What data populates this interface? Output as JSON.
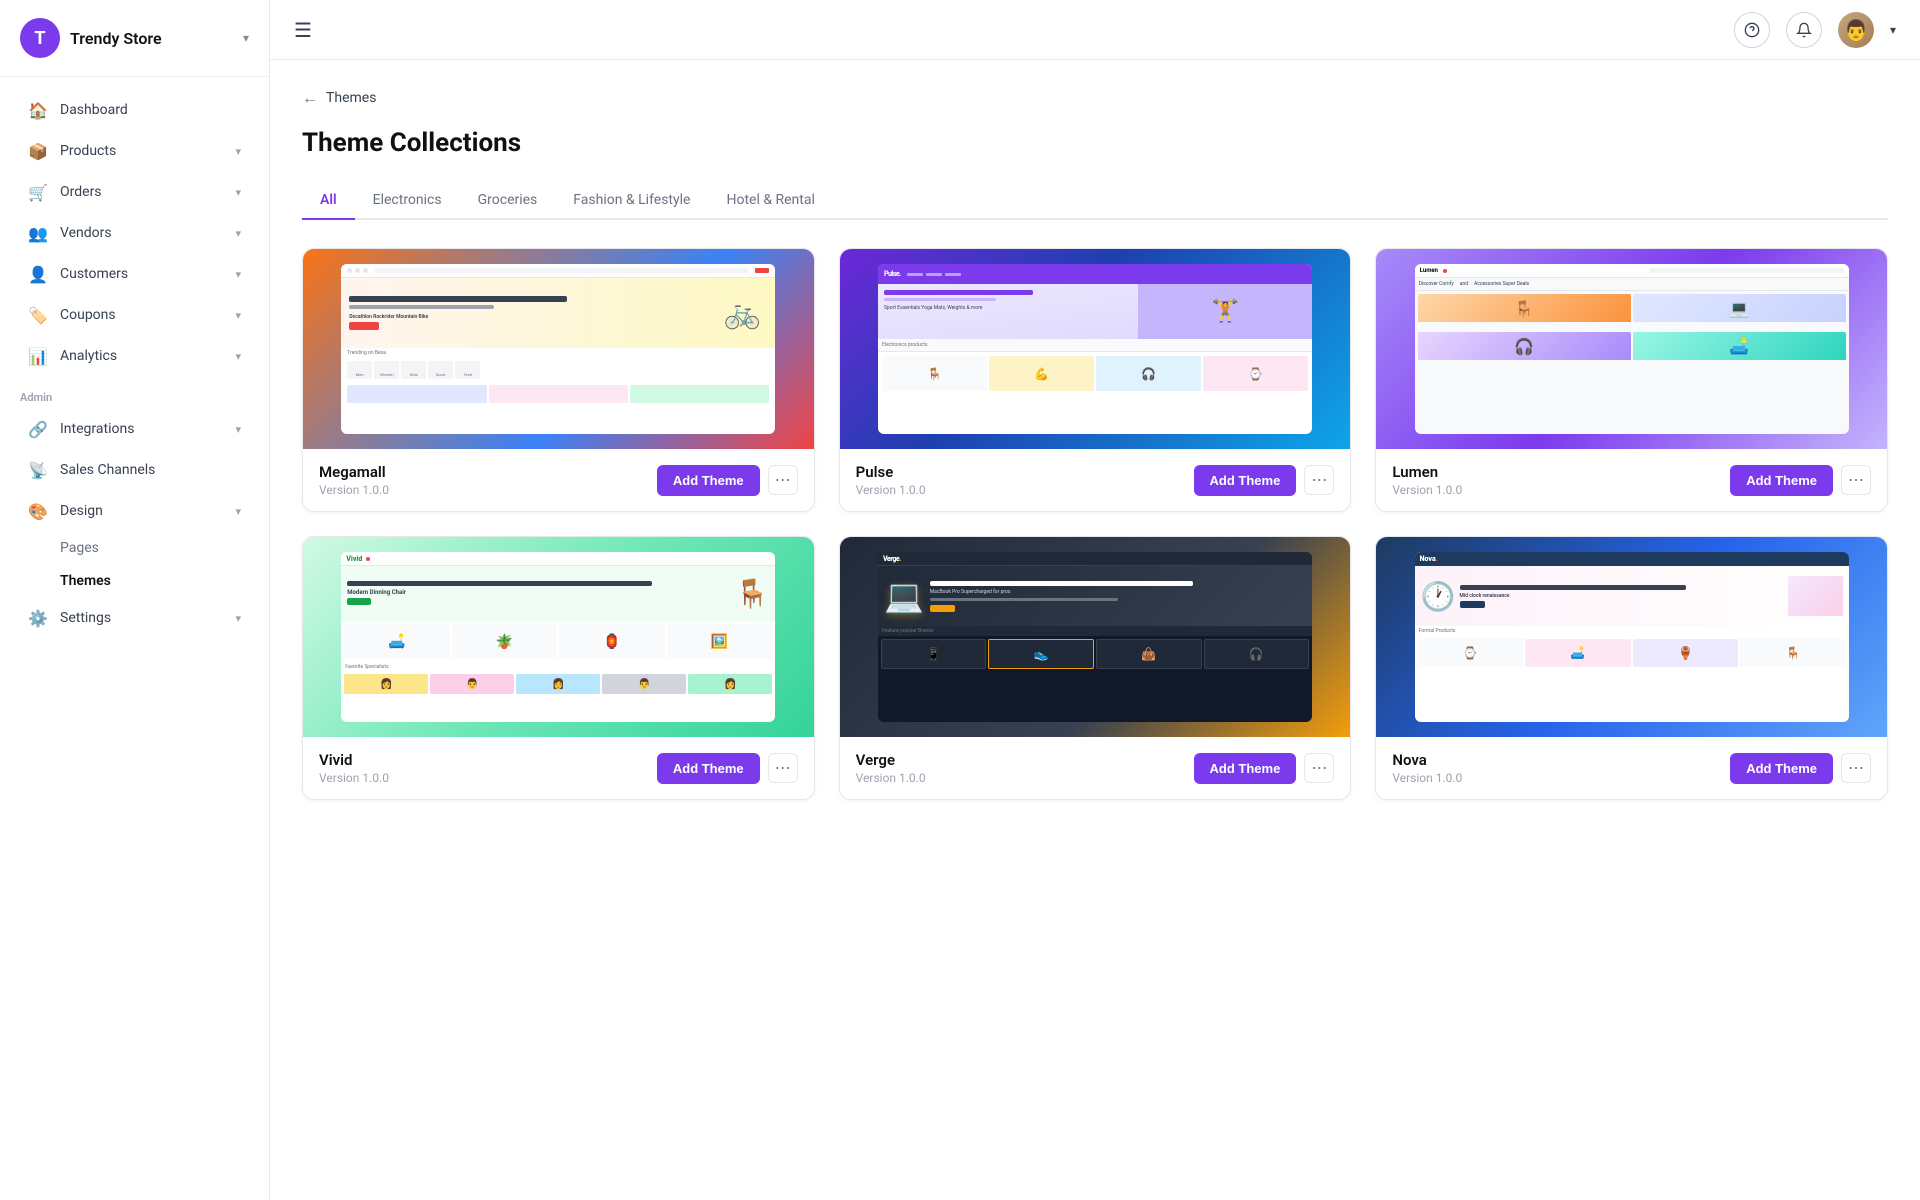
{
  "store": {
    "initial": "T",
    "name": "Trendy Store"
  },
  "sidebar": {
    "nav_items": [
      {
        "id": "dashboard",
        "label": "Dashboard",
        "icon": "🏠",
        "has_chevron": false
      },
      {
        "id": "products",
        "label": "Products",
        "icon": "📦",
        "has_chevron": true
      },
      {
        "id": "orders",
        "label": "Orders",
        "icon": "🛒",
        "has_chevron": true
      },
      {
        "id": "vendors",
        "label": "Vendors",
        "icon": "👥",
        "has_chevron": true
      },
      {
        "id": "customers",
        "label": "Customers",
        "icon": "👤",
        "has_chevron": true
      },
      {
        "id": "coupons",
        "label": "Coupons",
        "icon": "🏷️",
        "has_chevron": true
      },
      {
        "id": "analytics",
        "label": "Analytics",
        "icon": "📊",
        "has_chevron": true
      }
    ],
    "admin_label": "Admin",
    "admin_items": [
      {
        "id": "integrations",
        "label": "Integrations",
        "icon": "🔗",
        "has_chevron": true
      },
      {
        "id": "sales-channels",
        "label": "Sales Channels",
        "icon": "📡",
        "has_chevron": false
      },
      {
        "id": "design",
        "label": "Design",
        "icon": "🎨",
        "has_chevron": true
      }
    ],
    "design_sub_items": [
      {
        "id": "pages",
        "label": "Pages"
      },
      {
        "id": "themes",
        "label": "Themes",
        "active": true
      }
    ],
    "settings": {
      "id": "settings",
      "label": "Settings",
      "icon": "⚙️",
      "has_chevron": true
    }
  },
  "breadcrumb": {
    "back_label": "←",
    "page": "Themes"
  },
  "page": {
    "title": "Theme Collections",
    "tabs": [
      {
        "id": "all",
        "label": "All",
        "active": true
      },
      {
        "id": "electronics",
        "label": "Electronics"
      },
      {
        "id": "groceries",
        "label": "Groceries"
      },
      {
        "id": "fashion",
        "label": "Fashion & Lifestyle"
      },
      {
        "id": "hotel",
        "label": "Hotel & Rental"
      }
    ]
  },
  "themes": [
    {
      "id": "megamall",
      "name": "Megamall",
      "version": "Version 1.0.0",
      "add_label": "Add Theme"
    },
    {
      "id": "pulse",
      "name": "Pulse",
      "version": "Version 1.0.0",
      "add_label": "Add Theme"
    },
    {
      "id": "lumen",
      "name": "Lumen",
      "version": "Version 1.0.0",
      "add_label": "Add Theme"
    },
    {
      "id": "vivid",
      "name": "Vivid",
      "version": "Version 1.0.0",
      "add_label": "Add Theme"
    },
    {
      "id": "verge",
      "name": "Verge",
      "version": "Version 1.0.0",
      "add_label": "Add Theme"
    },
    {
      "id": "nova",
      "name": "Nova",
      "version": "Version 1.0.0",
      "add_label": "Add Theme"
    }
  ],
  "colors": {
    "accent": "#7c3aed",
    "accent_hover": "#6d28d9"
  }
}
